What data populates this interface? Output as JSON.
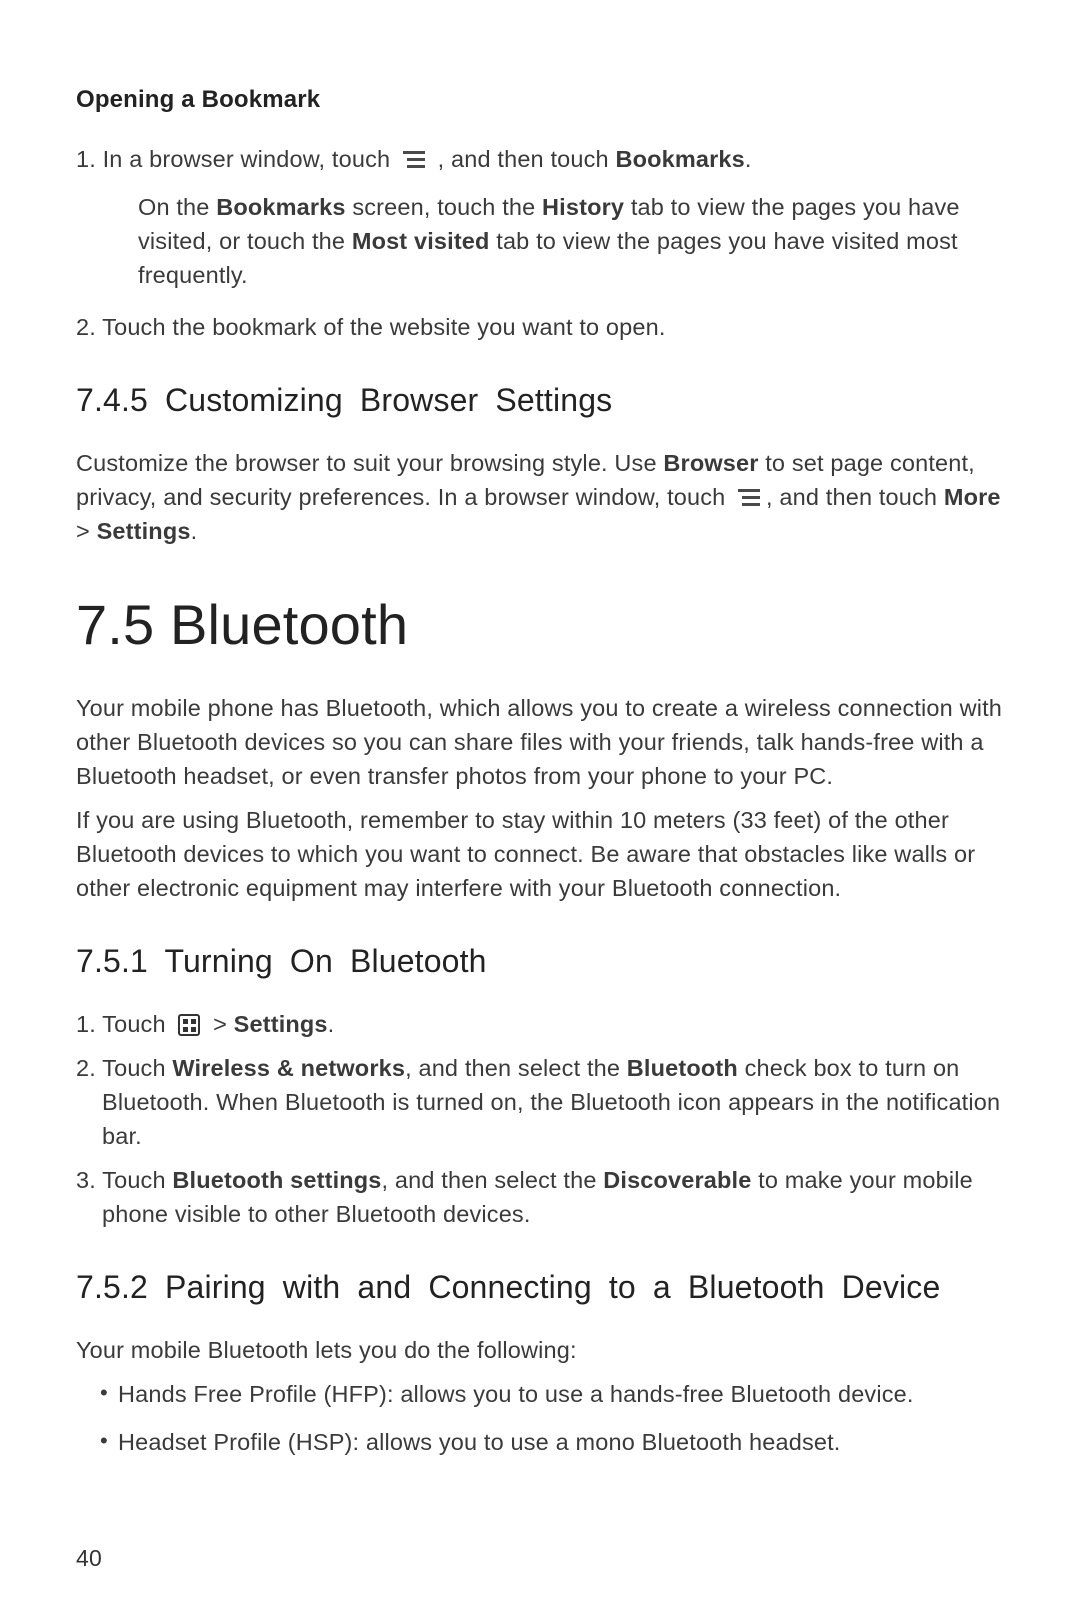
{
  "section_opening_bookmark": {
    "title": "Opening a Bookmark",
    "step1_pre": "1. In a browser window, touch",
    "step1_post": ", and then touch ",
    "step1_bold": "Bookmarks",
    "step1_end": ".",
    "nested_pre": "On the ",
    "nested_b1": "Bookmarks",
    "nested_mid1": " screen, touch the ",
    "nested_b2": "History",
    "nested_mid2": " tab to view the pages you have visited, or touch the ",
    "nested_b3": "Most visited",
    "nested_end": " tab to view the pages you have visited most frequently.",
    "step2": "2. Touch the bookmark of the website you want to open."
  },
  "section_745": {
    "heading": "7.4.5  Customizing Browser Settings",
    "p1_pre": "Customize the browser to suit your browsing style. Use ",
    "p1_b1": "Browser",
    "p1_mid": " to set page content, privacy, and security preferences. In a browser window, touch ",
    "p1_post": ", and then touch ",
    "p1_b2": "More",
    "p1_gt": " > ",
    "p1_b3": "Settings",
    "p1_end": "."
  },
  "section_75": {
    "heading": "7.5  Bluetooth",
    "p1": "Your mobile phone has Bluetooth, which allows you to create a wireless connection with other Bluetooth devices so you can share files with your friends, talk hands-free with a Bluetooth headset, or even transfer photos from your phone to your PC.",
    "p2": "If you are using Bluetooth, remember to stay within 10 meters (33 feet) of the other Bluetooth devices to which you want to connect. Be aware that obstacles like walls or other electronic equipment may interfere with your Bluetooth connection."
  },
  "section_751": {
    "heading": "7.5.1  Turning On Bluetooth",
    "step1_pre": "1. Touch ",
    "step1_gt": " > ",
    "step1_b1": "Settings",
    "step1_end": ".",
    "step2_pre": "2. Touch ",
    "step2_b1": "Wireless & networks",
    "step2_mid": ", and then select the ",
    "step2_b2": "Bluetooth",
    "step2_end": " check box to turn on Bluetooth. When Bluetooth is turned on, the Bluetooth icon appears in the notification bar.",
    "step3_pre": "3. Touch ",
    "step3_b1": "Bluetooth settings",
    "step3_mid": ", and then select the ",
    "step3_b2": "Discoverable",
    "step3_end": " to make your mobile phone visible to other Bluetooth devices."
  },
  "section_752": {
    "heading": "7.5.2  Pairing with and Connecting to a Bluetooth Device",
    "intro": "Your mobile Bluetooth lets you do the following:",
    "bullet1": "Hands Free Profile (HFP): allows you to use a hands-free Bluetooth device.",
    "bullet2": "Headset Profile (HSP): allows you to use a mono Bluetooth headset."
  },
  "page_number": "40"
}
